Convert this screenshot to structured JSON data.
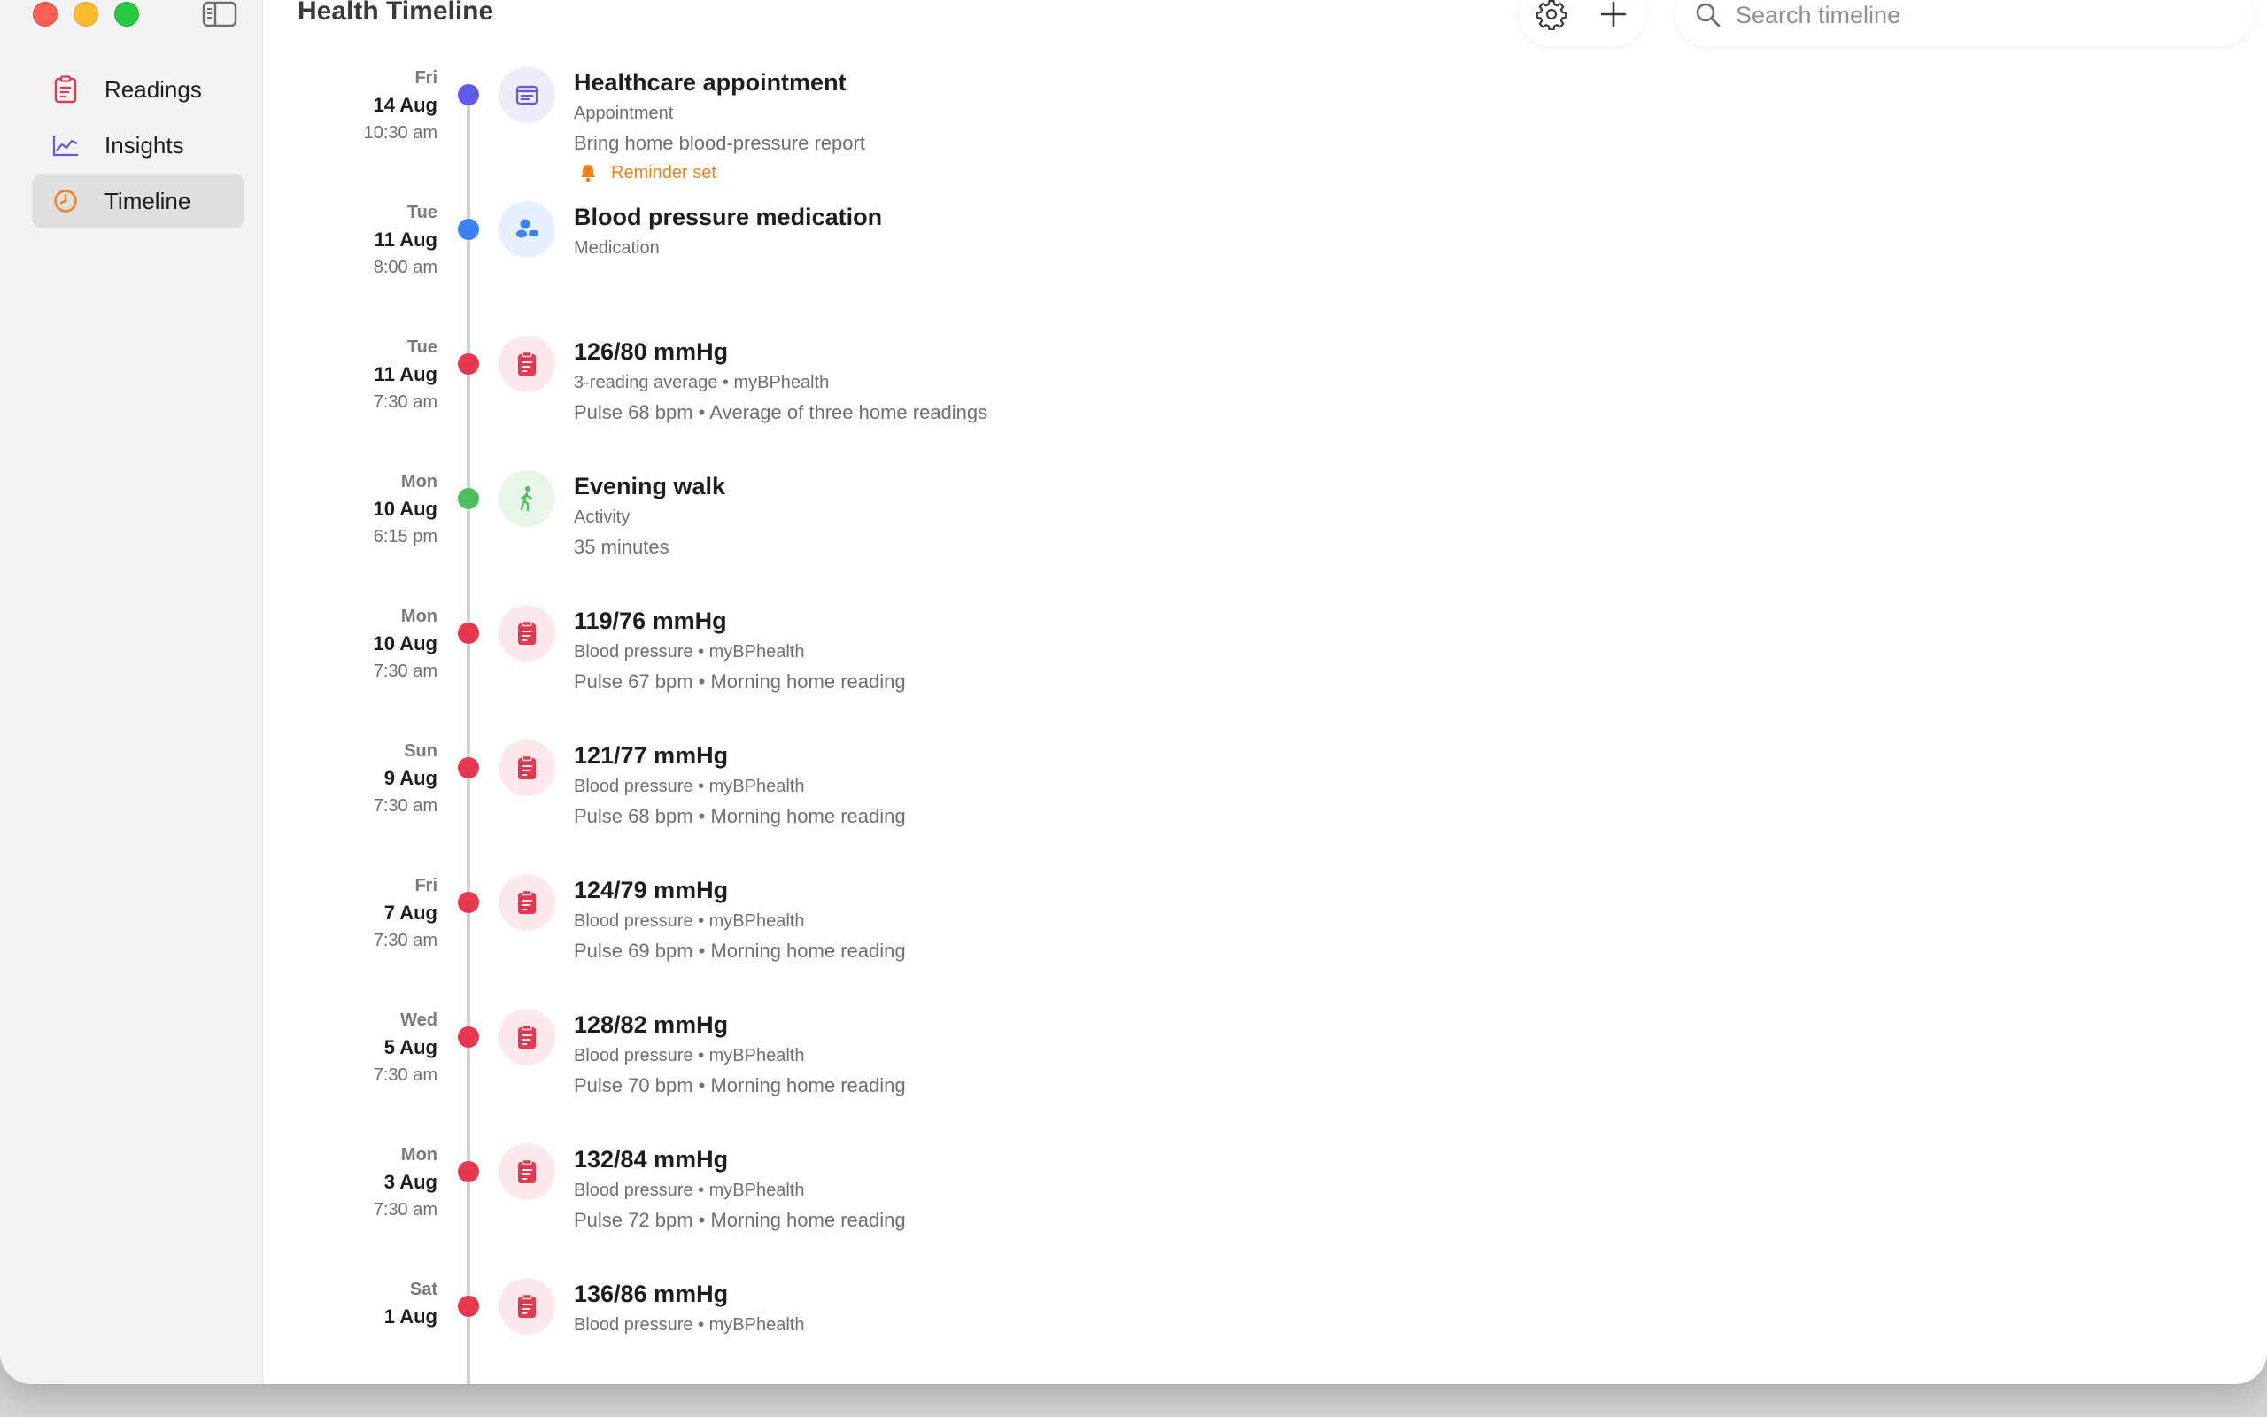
{
  "window": {
    "title": "Health Timeline"
  },
  "sidebar": {
    "items": [
      {
        "label": "Readings",
        "icon": "clipboard-icon"
      },
      {
        "label": "Insights",
        "icon": "chart-line-icon"
      },
      {
        "label": "Timeline",
        "icon": "clock-icon",
        "selected": true
      }
    ]
  },
  "toolbar": {
    "settings_icon": "gear-icon",
    "add_icon": "plus-icon"
  },
  "search": {
    "placeholder": "Search timeline",
    "value": ""
  },
  "colors": {
    "appointment": "#5e5ce6",
    "medication": "#3b82f6",
    "reading": "#e8384f",
    "activity": "#4cbf5a",
    "reminder": "#f0811a"
  },
  "timeline": [
    {
      "dow": "Fri",
      "day": "14 Aug",
      "time": "10:30 am",
      "kind": "appointment",
      "icon": "calendar-icon",
      "title": "Healthcare appointment",
      "subtitle": "Appointment",
      "detail": "Bring home blood-pressure report",
      "reminder": "Reminder set"
    },
    {
      "dow": "Tue",
      "day": "11 Aug",
      "time": "8:00 am",
      "kind": "medication",
      "icon": "pills-icon",
      "title": "Blood pressure medication",
      "subtitle": "Medication",
      "detail": ""
    },
    {
      "dow": "Tue",
      "day": "11 Aug",
      "time": "7:30 am",
      "kind": "reading",
      "icon": "clipboard-icon",
      "title": "126/80 mmHg",
      "subtitle": "3-reading average • myBPhealth",
      "detail": "Pulse 68 bpm • Average of three home readings"
    },
    {
      "dow": "Mon",
      "day": "10 Aug",
      "time": "6:15 pm",
      "kind": "activity",
      "icon": "walking-icon",
      "title": "Evening walk",
      "subtitle": "Activity",
      "detail": "35 minutes"
    },
    {
      "dow": "Mon",
      "day": "10 Aug",
      "time": "7:30 am",
      "kind": "reading",
      "icon": "clipboard-icon",
      "title": "119/76 mmHg",
      "subtitle": "Blood pressure • myBPhealth",
      "detail": "Pulse 67 bpm • Morning home reading"
    },
    {
      "dow": "Sun",
      "day": "9 Aug",
      "time": "7:30 am",
      "kind": "reading",
      "icon": "clipboard-icon",
      "title": "121/77 mmHg",
      "subtitle": "Blood pressure • myBPhealth",
      "detail": "Pulse 68 bpm • Morning home reading"
    },
    {
      "dow": "Fri",
      "day": "7 Aug",
      "time": "7:30 am",
      "kind": "reading",
      "icon": "clipboard-icon",
      "title": "124/79 mmHg",
      "subtitle": "Blood pressure • myBPhealth",
      "detail": "Pulse 69 bpm • Morning home reading"
    },
    {
      "dow": "Wed",
      "day": "5 Aug",
      "time": "7:30 am",
      "kind": "reading",
      "icon": "clipboard-icon",
      "title": "128/82 mmHg",
      "subtitle": "Blood pressure • myBPhealth",
      "detail": "Pulse 70 bpm • Morning home reading"
    },
    {
      "dow": "Mon",
      "day": "3 Aug",
      "time": "7:30 am",
      "kind": "reading",
      "icon": "clipboard-icon",
      "title": "132/84 mmHg",
      "subtitle": "Blood pressure • myBPhealth",
      "detail": "Pulse 72 bpm • Morning home reading"
    },
    {
      "dow": "Sat",
      "day": "1 Aug",
      "time": "",
      "kind": "reading",
      "icon": "clipboard-icon",
      "title": "136/86 mmHg",
      "subtitle": "Blood pressure • myBPhealth",
      "detail": ""
    }
  ]
}
